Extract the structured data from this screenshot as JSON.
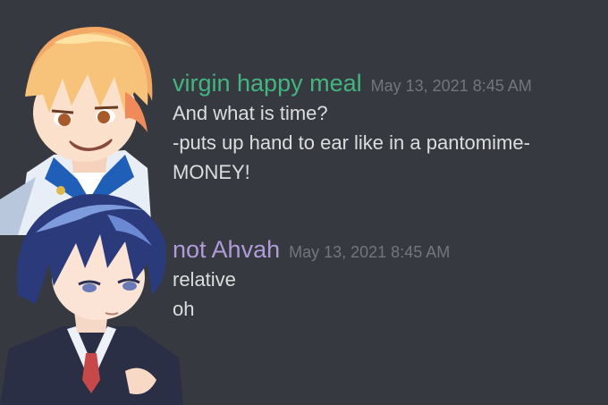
{
  "messages": [
    {
      "username": "virgin happy meal",
      "username_color": "#43b581",
      "timestamp": "May 13, 2021 8:45 AM",
      "lines": [
        "And what is time?",
        "-puts up hand to ear like in a pantomime-",
        "MONEY!"
      ]
    },
    {
      "username": "not Ahvah",
      "username_color": "#b19cd9",
      "timestamp": "May 13, 2021 8:45 AM",
      "lines": [
        "relative",
        "oh"
      ]
    }
  ],
  "colors": {
    "background": "#36393f",
    "message_text": "#dcddde",
    "timestamp": "#72767d"
  },
  "avatars": [
    "orange-haired-boy-illustration",
    "blue-haired-boy-illustration"
  ]
}
